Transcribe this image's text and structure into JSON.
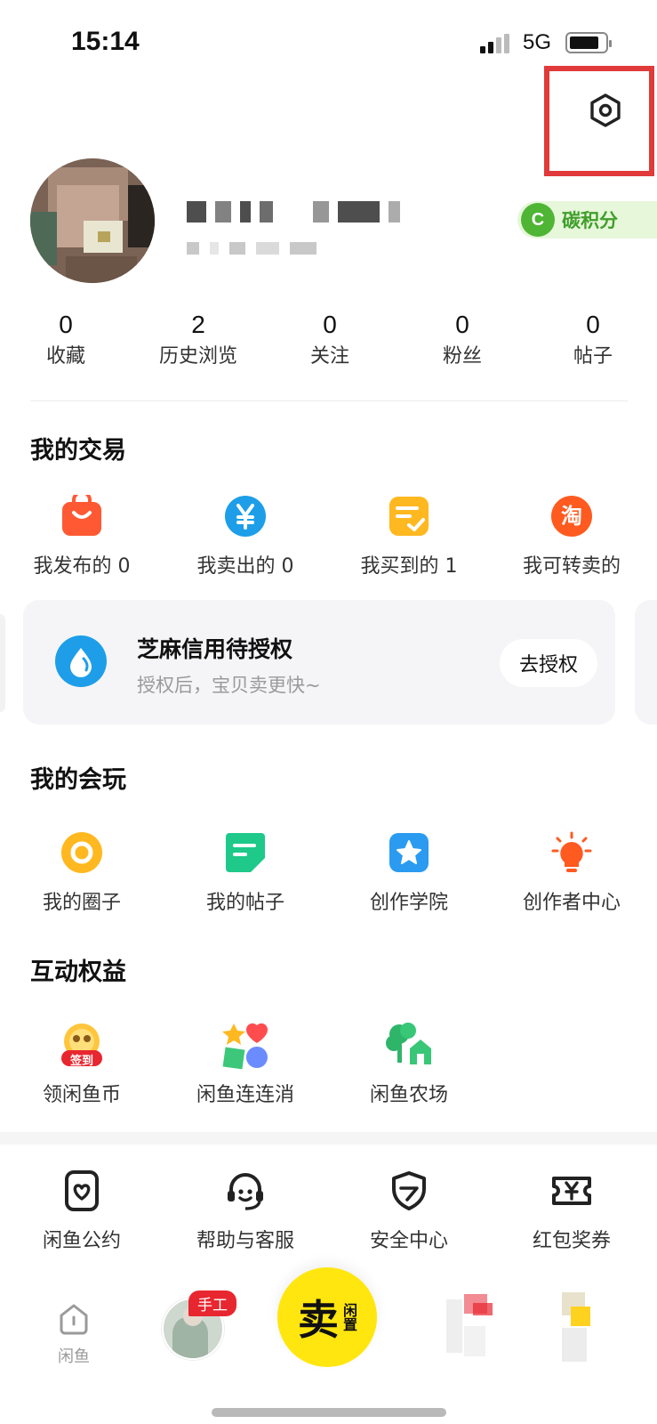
{
  "status_bar": {
    "time": "15:14",
    "network": "5G"
  },
  "header": {
    "settings_icon": "hexagon-settings-icon",
    "highlight_color": "#e03a3a"
  },
  "profile": {
    "carbon_badge_letter": "C",
    "carbon_badge_label": "碳积分"
  },
  "stats": [
    {
      "value": "0",
      "label": "收藏"
    },
    {
      "value": "2",
      "label": "历史浏览"
    },
    {
      "value": "0",
      "label": "关注"
    },
    {
      "value": "0",
      "label": "粉丝"
    },
    {
      "value": "0",
      "label": "帖子"
    }
  ],
  "trade": {
    "title": "我的交易",
    "items": [
      {
        "label": "我发布的 0",
        "icon": "bag-icon"
      },
      {
        "label": "我卖出的 0",
        "icon": "yen-icon"
      },
      {
        "label": "我买到的 1",
        "icon": "order-check-icon"
      },
      {
        "label": "我可转卖的",
        "icon": "tao-icon"
      }
    ]
  },
  "zhima": {
    "title": "芝麻信用待授权",
    "subtitle": "授权后，宝贝卖更快~",
    "button": "去授权",
    "icon": "water-drop-icon"
  },
  "play": {
    "title": "我的会玩",
    "items": [
      {
        "label": "我的圈子",
        "icon": "circle-icon"
      },
      {
        "label": "我的帖子",
        "icon": "post-icon"
      },
      {
        "label": "创作学院",
        "icon": "star-icon"
      },
      {
        "label": "创作者中心",
        "icon": "lightbulb-icon"
      }
    ]
  },
  "benefits": {
    "title": "互动权益",
    "checkin_badge": "签到",
    "items": [
      {
        "label": "领闲鱼币",
        "icon": "checkin-coin-icon"
      },
      {
        "label": "闲鱼连连消",
        "icon": "match-game-icon"
      },
      {
        "label": "闲鱼农场",
        "icon": "farm-icon"
      }
    ]
  },
  "services": [
    {
      "label": "闲鱼公约",
      "icon": "heart-doc-icon"
    },
    {
      "label": "帮助与客服",
      "icon": "headset-icon"
    },
    {
      "label": "安全中心",
      "icon": "shield-icon"
    },
    {
      "label": "红包奖券",
      "icon": "ticket-icon"
    }
  ],
  "tabbar": {
    "home_label": "闲鱼",
    "feed_badge": "手工",
    "sell_main": "卖",
    "sell_side": "闲置"
  },
  "colors": {
    "sell_yellow": "#ffe60f",
    "carbon_green": "#4fb534",
    "zhima_blue": "#1e9ee8",
    "badge_red": "#e8262f"
  }
}
